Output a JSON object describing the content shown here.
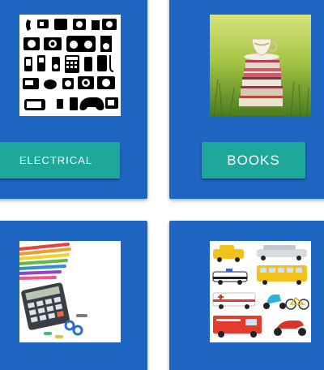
{
  "colors": {
    "card": "#1f66c3",
    "button": "#1ea89c",
    "button_text": "#ffffff"
  },
  "categories": [
    {
      "id": "electrical",
      "label": "ELECTRICAL",
      "image": "electronics-icons-image"
    },
    {
      "id": "books",
      "label": "BOOKS",
      "image": "books-with-teacup-image"
    },
    {
      "id": "stationery",
      "label": "",
      "image": "stationery-calculator-image"
    },
    {
      "id": "vehicles",
      "label": "",
      "image": "vehicles-illustration-image"
    }
  ]
}
